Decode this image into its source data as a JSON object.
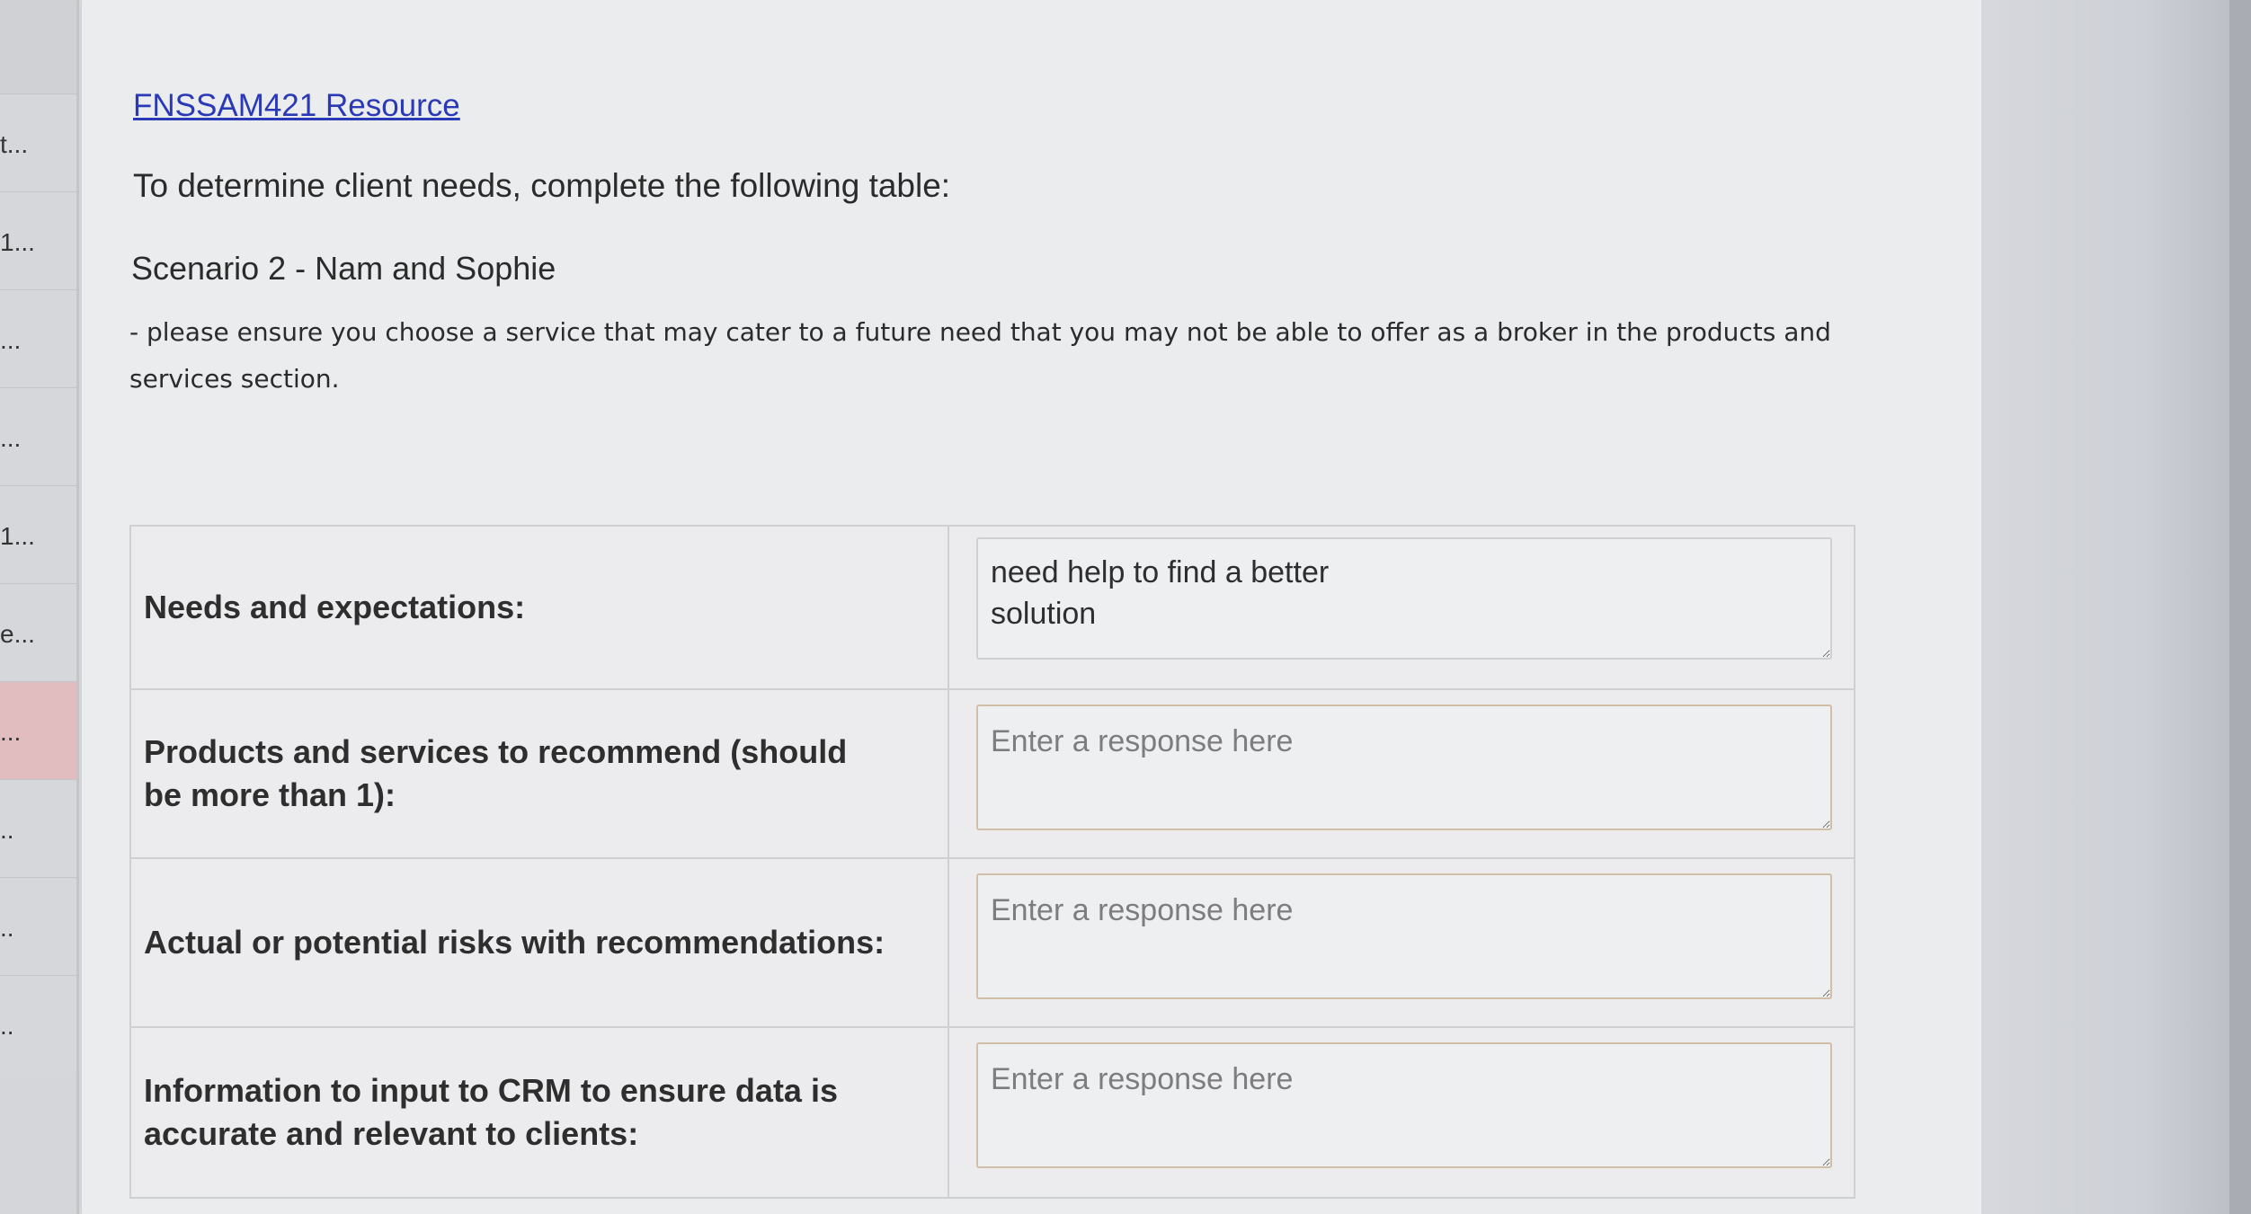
{
  "sidebar": {
    "items": [
      {
        "label": "t..."
      },
      {
        "label": "1..."
      },
      {
        "label": "..."
      },
      {
        "label": "..."
      },
      {
        "label": "1..."
      },
      {
        "label": "e..."
      },
      {
        "label": "..."
      },
      {
        "label": ".."
      },
      {
        "label": ".."
      },
      {
        "label": ".."
      }
    ]
  },
  "main": {
    "resource_link": "FNSSAM421 Resource",
    "instruction": "To determine client needs, complete the following table:",
    "scenario": "Scenario 2 - Nam and Sophie",
    "note": "- please ensure you choose a service that may cater to a future need that you may not be able to offer as a broker in the products and services section."
  },
  "table": {
    "rows": [
      {
        "label": "Needs and expectations:",
        "value": "need help to find a better\nsolution",
        "placeholder": "Enter a response here"
      },
      {
        "label": "Products and services to recommend (should be more than 1):",
        "value": "",
        "placeholder": "Enter a response here"
      },
      {
        "label": "Actual or potential risks with recommendations:",
        "value": "",
        "placeholder": "Enter a response here"
      },
      {
        "label": "Information to input to CRM to ensure data is accurate and relevant to clients:",
        "value": "",
        "placeholder": "Enter a response here"
      }
    ]
  }
}
